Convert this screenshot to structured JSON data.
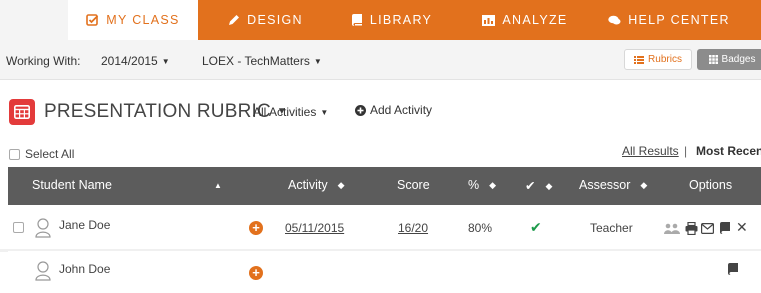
{
  "nav": {
    "items": [
      {
        "label": "MY CLASS",
        "icon": "check-square-icon",
        "active": true
      },
      {
        "label": "DESIGN",
        "icon": "pencil-icon",
        "active": false
      },
      {
        "label": "LIBRARY",
        "icon": "book-icon",
        "active": false
      },
      {
        "label": "ANALYZE",
        "icon": "chart-icon",
        "active": false
      },
      {
        "label": "HELP CENTER",
        "icon": "comments-icon",
        "active": false
      }
    ],
    "accent": "#e2711d"
  },
  "workbar": {
    "label": "Working With:",
    "year": "2014/2015",
    "course": "LOEX - TechMatters",
    "rubrics_button": "Rubrics",
    "badges_button": "Badges"
  },
  "rubric": {
    "title": "PRESENTATION RUBRIC",
    "activities_filter": "All Activities",
    "add_activity": "Add Activity",
    "icon_color": "#e33b3b"
  },
  "controls": {
    "select_all": "Select All",
    "all_results": "All Results",
    "separator": "|",
    "most_recent": "Most Recent"
  },
  "table": {
    "headers": {
      "student_name": "Student Name",
      "activity": "Activity",
      "score": "Score",
      "percent": "%",
      "assessor": "Assessor",
      "options": "Options"
    },
    "rows": [
      {
        "name": "Jane Doe",
        "activity": "05/11/2015",
        "score": "16/20",
        "percent": "80%",
        "assessor": "Teacher",
        "completed": true,
        "has_checkbox": true
      },
      {
        "name": "John Doe",
        "activity": "",
        "score": "",
        "percent": "",
        "assessor": "",
        "completed": false,
        "has_checkbox": false
      }
    ]
  }
}
